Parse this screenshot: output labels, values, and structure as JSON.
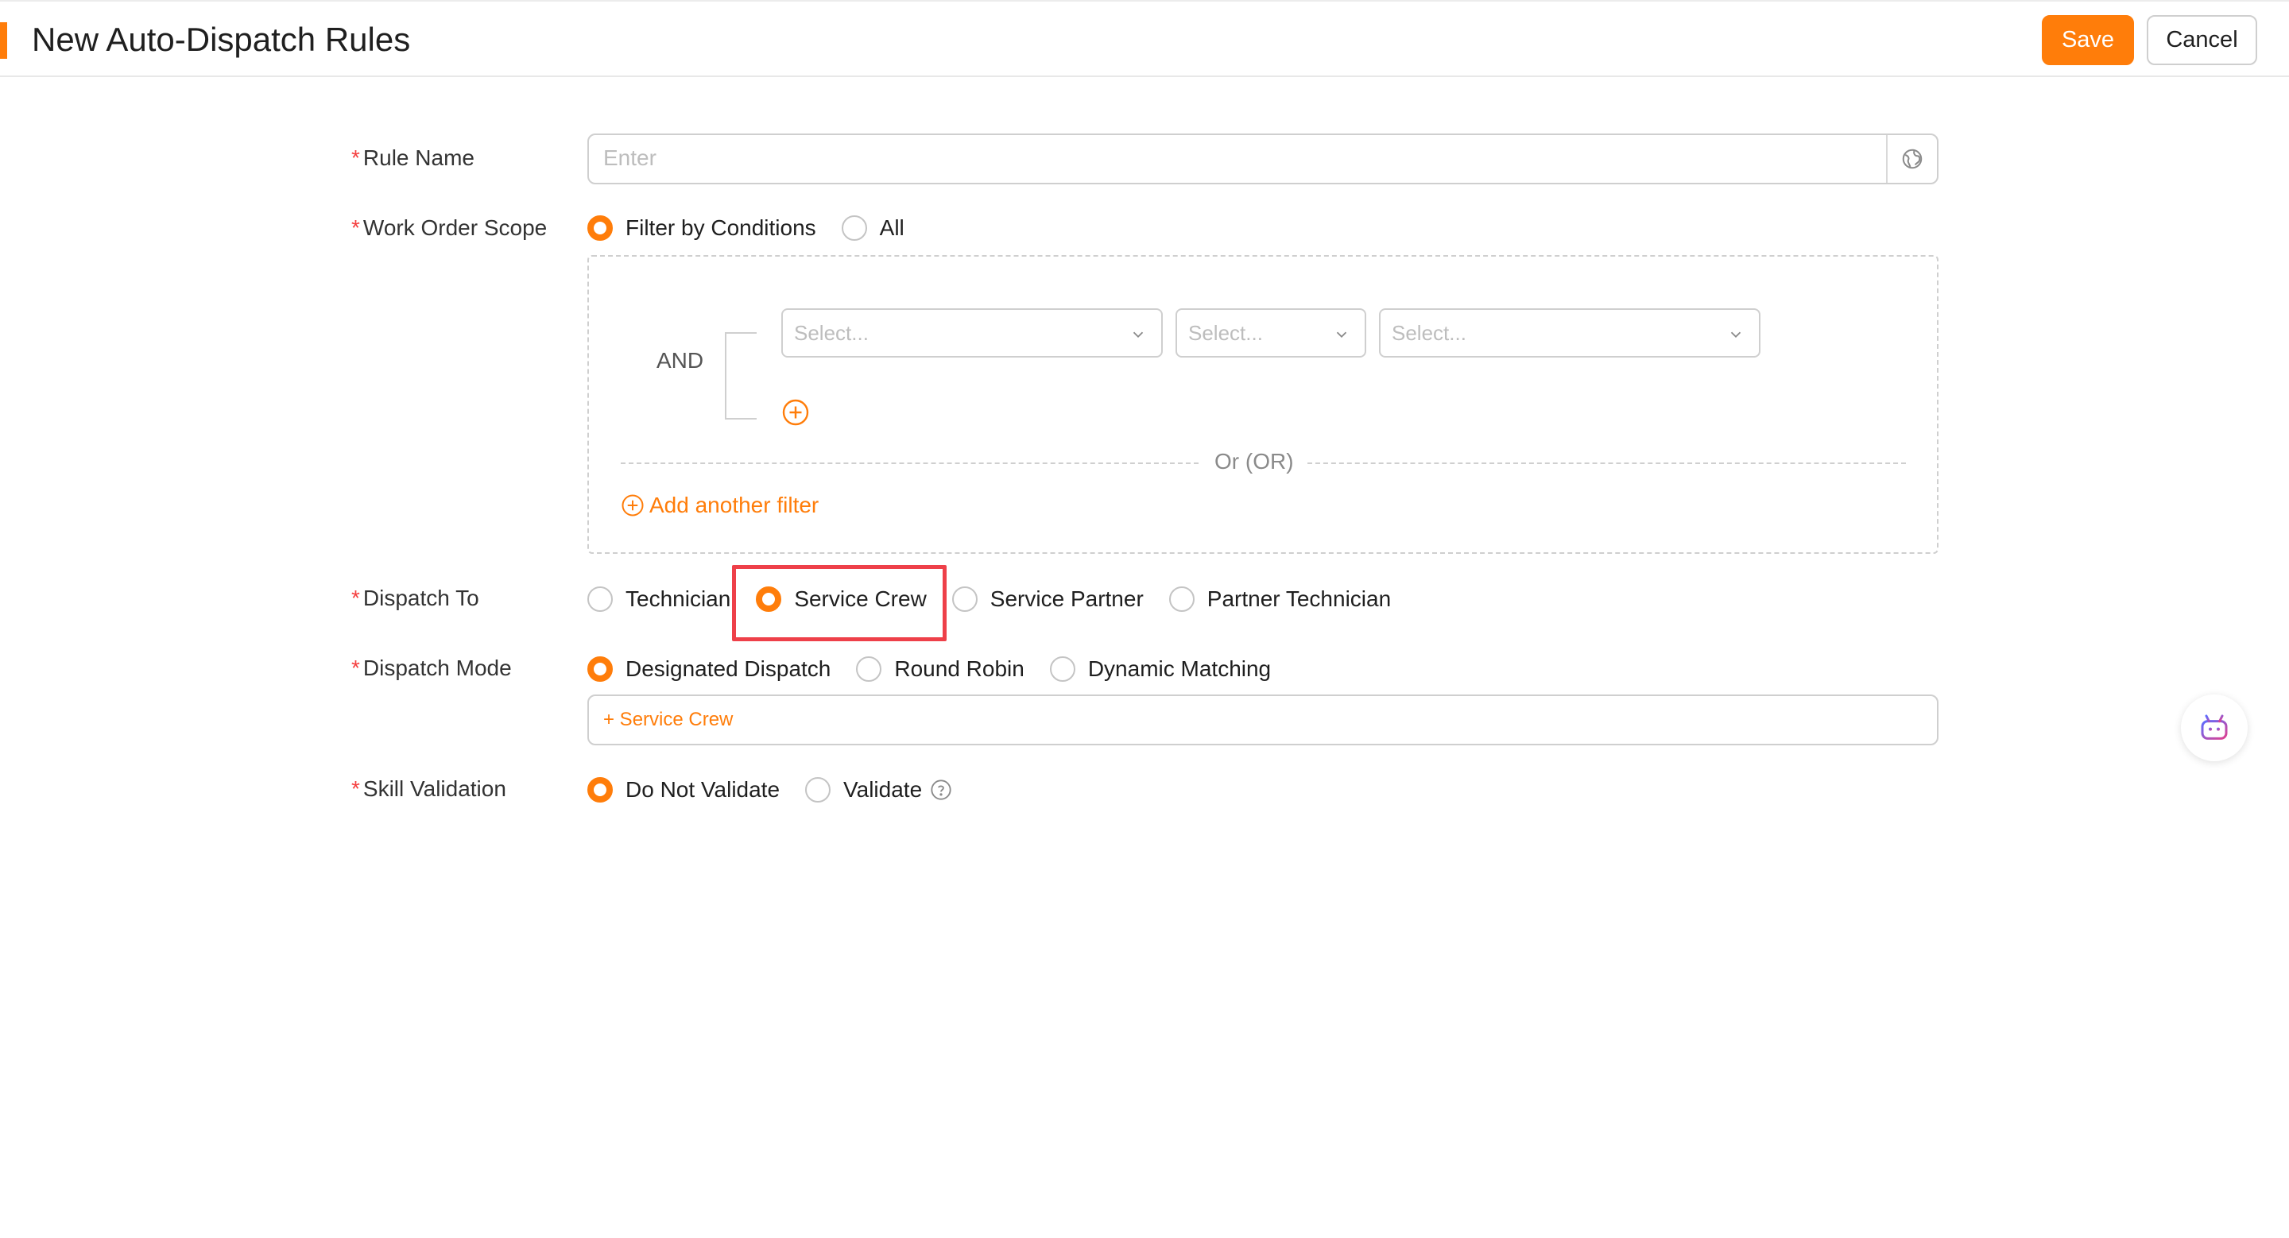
{
  "header": {
    "title": "New Auto-Dispatch Rules",
    "save_label": "Save",
    "cancel_label": "Cancel",
    "accent_color": "#ff7d0a"
  },
  "form": {
    "required_mark": "*",
    "rule_name": {
      "label": "Rule Name",
      "placeholder": "Enter",
      "addon_icon": "globe-icon"
    },
    "work_order_scope": {
      "label": "Work Order Scope",
      "options": [
        {
          "label": "Filter by Conditions",
          "checked": true
        },
        {
          "label": "All",
          "checked": false
        }
      ],
      "filter": {
        "and_label": "AND",
        "selects": [
          {
            "placeholder": "Select..."
          },
          {
            "placeholder": "Select..."
          },
          {
            "placeholder": "Select..."
          }
        ],
        "or_label": "Or (OR)",
        "add_filter_label": "Add another filter"
      }
    },
    "dispatch_to": {
      "label": "Dispatch To",
      "options": [
        {
          "label": "Technician",
          "checked": false
        },
        {
          "label": "Service Crew",
          "checked": true
        },
        {
          "label": "Service Partner",
          "checked": false
        },
        {
          "label": "Partner Technician",
          "checked": false
        }
      ]
    },
    "dispatch_mode": {
      "label": "Dispatch Mode",
      "options": [
        {
          "label": "Designated Dispatch",
          "checked": true
        },
        {
          "label": "Round Robin",
          "checked": false
        },
        {
          "label": "Dynamic Matching",
          "checked": false
        }
      ],
      "add_tag_label": "+ Service Crew"
    },
    "skill_validation": {
      "label": "Skill Validation",
      "options": [
        {
          "label": "Do Not Validate",
          "checked": true
        },
        {
          "label": "Validate",
          "checked": false
        }
      ],
      "help_icon": "question-circle-icon"
    }
  },
  "colors": {
    "primary": "#ff7d0a",
    "highlight_border": "#ee4049",
    "required": "#f53f3f"
  }
}
